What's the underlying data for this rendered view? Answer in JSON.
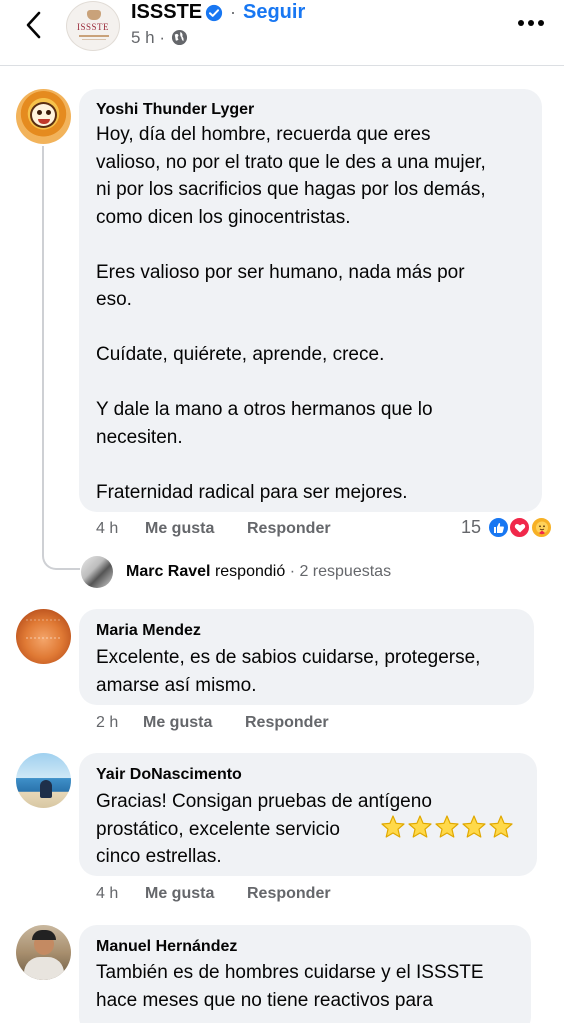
{
  "header": {
    "page_name": "ISSSTE",
    "avatar_abbr": "ISSSTE",
    "separator": "·",
    "follow_label": "Seguir",
    "time": "5 h ·",
    "icons": {
      "back": "chevron-left-icon",
      "verified": "verified-badge-icon",
      "audience": "globe-icon",
      "more": "more-horizontal-icon"
    }
  },
  "comments": [
    {
      "author": "Yoshi Thunder Lyger",
      "text": "Hoy, día del hombre, recuerda que eres\nvalioso, no por el trato que le des a una mujer,\nni por los sacrificios que hagas por los demás,\ncomo dicen los ginocentristas.\n\nEres valioso por ser humano, nada más por\neso.\n\nCuídate, quiérete, aprende, crece.\n\nY dale la mano a otros hermanos que lo\nnecesiten.\n\nFraternidad radical para ser mejores.",
      "time": "4 h",
      "like_label": "Me gusta",
      "reply_label": "Responder",
      "reaction_count": "15",
      "reaction_icons": [
        "like-reaction-icon",
        "love-reaction-icon",
        "care-reaction-icon"
      ],
      "replies": {
        "name": "Marc Ravel",
        "verb": "respondió",
        "count_text": "· 2 respuestas"
      }
    },
    {
      "author": "Maria Mendez",
      "text": "Excelente, es de sabios cuidarse, protegerse,\namarse así mismo.",
      "time": "2 h",
      "like_label": "Me gusta",
      "reply_label": "Responder"
    },
    {
      "author": "Yair DoNascimento",
      "text": "Gracias! Consigan pruebas de antígeno\nprostático, excelente servicio\ncinco estrellas.",
      "emoji": "star-emoji ×5",
      "time": "4 h",
      "like_label": "Me gusta",
      "reply_label": "Responder"
    },
    {
      "author": "Manuel Hernández",
      "text": "También es de hombres cuidarse y el ISSSTE\nhace meses que no tiene reactivos para"
    }
  ],
  "colors": {
    "accent": "#1877f2",
    "secondary_text": "#65676b",
    "bubble": "#f0f2f5",
    "love": "#f0284a",
    "care": "#f7b125"
  }
}
